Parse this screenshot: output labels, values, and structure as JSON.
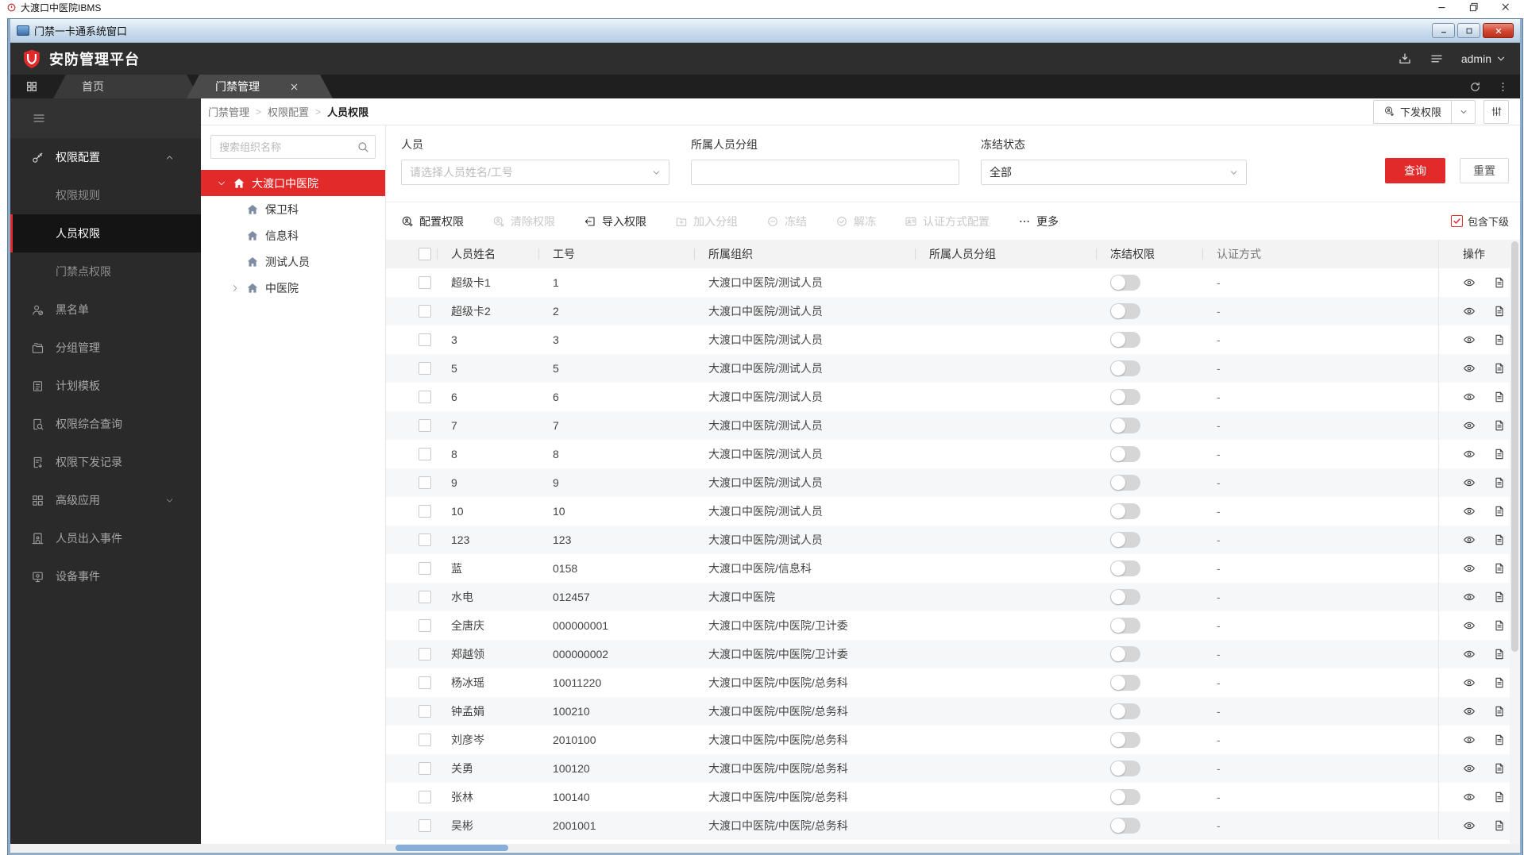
{
  "os_titlebar": {
    "title": "大渡口中医院IBMS"
  },
  "window_titlebar": {
    "title": "门禁一卡通系统窗口"
  },
  "header": {
    "brand": "安防管理平台",
    "user": "admin"
  },
  "tabs": [
    {
      "label": "首页",
      "active": false
    },
    {
      "label": "门禁管理",
      "active": true
    }
  ],
  "breadcrumb": {
    "items": [
      "门禁管理",
      "权限配置",
      "人员权限"
    ],
    "separator": ">"
  },
  "page_actions": {
    "dispatch_label": "下发权限"
  },
  "sidebar": {
    "items": [
      {
        "name": "permission-config",
        "label": "权限配置",
        "icon": "key-icon",
        "type": "group",
        "expanded": true
      },
      {
        "name": "permission-rules",
        "label": "权限规则",
        "type": "sub",
        "active": false
      },
      {
        "name": "person-permission",
        "label": "人员权限",
        "type": "sub",
        "active": true
      },
      {
        "name": "door-permission",
        "label": "门禁点权限",
        "type": "sub",
        "active": false
      },
      {
        "name": "blacklist",
        "label": "黑名单",
        "icon": "blacklist-icon"
      },
      {
        "name": "group-management",
        "label": "分组管理",
        "icon": "folders-icon"
      },
      {
        "name": "plan-template",
        "label": "计划模板",
        "icon": "template-icon"
      },
      {
        "name": "permission-query",
        "label": "权限综合查询",
        "icon": "search-doc-icon"
      },
      {
        "name": "permission-dispatch-record",
        "label": "权限下发记录",
        "icon": "record-icon"
      },
      {
        "name": "advanced-apps",
        "label": "高级应用",
        "icon": "apps-icon",
        "collapsible": true
      },
      {
        "name": "person-access-events",
        "label": "人员出入事件",
        "icon": "door-icon"
      },
      {
        "name": "device-events",
        "label": "设备事件",
        "icon": "device-icon"
      }
    ]
  },
  "org_panel": {
    "search_placeholder": "搜索组织名称",
    "tree": [
      {
        "label": "大渡口中医院",
        "level": 0,
        "selected": true,
        "expander": "down"
      },
      {
        "label": "保卫科",
        "level": 1,
        "selected": false,
        "expander": ""
      },
      {
        "label": "信息科",
        "level": 1,
        "selected": false,
        "expander": ""
      },
      {
        "label": "测试人员",
        "level": 1,
        "selected": false,
        "expander": ""
      },
      {
        "label": "中医院",
        "level": 1,
        "selected": false,
        "expander": "right"
      }
    ]
  },
  "filters": {
    "person": {
      "label": "人员",
      "placeholder": "请选择人员姓名/工号"
    },
    "group": {
      "label": "所属人员分组",
      "value": ""
    },
    "freeze": {
      "label": "冻结状态",
      "value": "全部"
    },
    "search_button": "查询",
    "reset_button": "重置"
  },
  "toolbar": {
    "buttons": [
      {
        "name": "config-permission",
        "label": "配置权限",
        "icon": "badge-plus-icon",
        "enabled": true
      },
      {
        "name": "clear-permission",
        "label": "清除权限",
        "icon": "badge-clear-icon",
        "enabled": false
      },
      {
        "name": "import-permission",
        "label": "导入权限",
        "icon": "import-icon",
        "enabled": true
      },
      {
        "name": "add-to-group",
        "label": "加入分组",
        "icon": "folder-plus-icon",
        "enabled": false
      },
      {
        "name": "freeze",
        "label": "冻结",
        "icon": "freeze-icon",
        "enabled": false
      },
      {
        "name": "unfreeze",
        "label": "解冻",
        "icon": "unfreeze-icon",
        "enabled": false
      },
      {
        "name": "auth-mode-config",
        "label": "认证方式配置",
        "icon": "auth-icon",
        "enabled": false
      },
      {
        "name": "more",
        "label": "更多",
        "icon": "more-icon",
        "enabled": true
      }
    ],
    "include_sub": {
      "label": "包含下级",
      "checked": true
    }
  },
  "table": {
    "columns": [
      "人员姓名",
      "工号",
      "所属组织",
      "所属人员分组",
      "冻结权限",
      "认证方式",
      "操作"
    ],
    "rows": [
      {
        "name": "超级卡1",
        "id": "1",
        "org": "大渡口中医院/测试人员",
        "group": "",
        "frozen": false,
        "auth": "-"
      },
      {
        "name": "超级卡2",
        "id": "2",
        "org": "大渡口中医院/测试人员",
        "group": "",
        "frozen": false,
        "auth": "-"
      },
      {
        "name": "3",
        "id": "3",
        "org": "大渡口中医院/测试人员",
        "group": "",
        "frozen": false,
        "auth": "-"
      },
      {
        "name": "5",
        "id": "5",
        "org": "大渡口中医院/测试人员",
        "group": "",
        "frozen": false,
        "auth": "-"
      },
      {
        "name": "6",
        "id": "6",
        "org": "大渡口中医院/测试人员",
        "group": "",
        "frozen": false,
        "auth": "-"
      },
      {
        "name": "7",
        "id": "7",
        "org": "大渡口中医院/测试人员",
        "group": "",
        "frozen": false,
        "auth": "-"
      },
      {
        "name": "8",
        "id": "8",
        "org": "大渡口中医院/测试人员",
        "group": "",
        "frozen": false,
        "auth": "-"
      },
      {
        "name": "9",
        "id": "9",
        "org": "大渡口中医院/测试人员",
        "group": "",
        "frozen": false,
        "auth": "-"
      },
      {
        "name": "10",
        "id": "10",
        "org": "大渡口中医院/测试人员",
        "group": "",
        "frozen": false,
        "auth": "-"
      },
      {
        "name": "123",
        "id": "123",
        "org": "大渡口中医院/测试人员",
        "group": "",
        "frozen": false,
        "auth": "-"
      },
      {
        "name": "蓝",
        "id": "0158",
        "org": "大渡口中医院/信息科",
        "group": "",
        "frozen": false,
        "auth": "-"
      },
      {
        "name": "水电",
        "id": "012457",
        "org": "大渡口中医院",
        "group": "",
        "frozen": false,
        "auth": "-"
      },
      {
        "name": "全唐庆",
        "id": "000000001",
        "org": "大渡口中医院/中医院/卫计委",
        "group": "",
        "frozen": false,
        "auth": "-"
      },
      {
        "name": "郑越领",
        "id": "000000002",
        "org": "大渡口中医院/中医院/卫计委",
        "group": "",
        "frozen": false,
        "auth": "-"
      },
      {
        "name": "杨冰瑶",
        "id": "10011220",
        "org": "大渡口中医院/中医院/总务科",
        "group": "",
        "frozen": false,
        "auth": "-"
      },
      {
        "name": "钟孟娟",
        "id": "100210",
        "org": "大渡口中医院/中医院/总务科",
        "group": "",
        "frozen": false,
        "auth": "-"
      },
      {
        "name": "刘彦岑",
        "id": "2010100",
        "org": "大渡口中医院/中医院/总务科",
        "group": "",
        "frozen": false,
        "auth": "-"
      },
      {
        "name": "关勇",
        "id": "100120",
        "org": "大渡口中医院/中医院/总务科",
        "group": "",
        "frozen": false,
        "auth": "-"
      },
      {
        "name": "张林",
        "id": "100140",
        "org": "大渡口中医院/中医院/总务科",
        "group": "",
        "frozen": false,
        "auth": "-"
      },
      {
        "name": "吴彬",
        "id": "2001001",
        "org": "大渡口中医院/中医院/总务科",
        "group": "",
        "frozen": false,
        "auth": "-"
      }
    ]
  },
  "colors": {
    "accent": "#e32a2a",
    "sidebar_bg": "#2a2a2a",
    "header_bg": "#2f2e2e"
  }
}
